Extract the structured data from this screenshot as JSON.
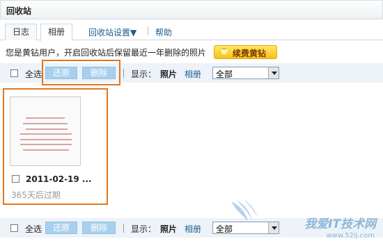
{
  "title": "回收站",
  "tabs": [
    "日志",
    "相册"
  ],
  "nav": {
    "settings": "回收站设置▼",
    "help": "帮助"
  },
  "notice": "您是黄钻用户，开启回收站后保留最近一年删除的照片",
  "vip_button": "续费黄钻",
  "actions": {
    "select_all": "全选",
    "restore": "还原",
    "delete": "删除",
    "display_label": "显示：",
    "photos": "照片",
    "albums": "相册",
    "filter": "全部"
  },
  "photo": {
    "date": "2011-02-19 ...",
    "expire": "365天后过期"
  },
  "watermark": {
    "cn": "我爱IT技术网",
    "url": "www.52ij.com"
  },
  "colors": {
    "highlight": "#e2761a",
    "link": "#1d5c8c",
    "vip": "#f7c21a"
  }
}
